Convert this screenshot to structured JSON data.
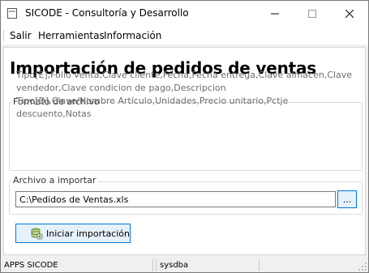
{
  "window": {
    "title": "SICODE - Consultoría y Desarrollo"
  },
  "menu": {
    "items": [
      "Salir",
      "Herramientas",
      "Información"
    ]
  },
  "page": {
    "title": "Importación de pedidos de ventas"
  },
  "format_group": {
    "label": "Formato de archivo",
    "lines": [
      "Tipo[E],Folio venta,Clave cliente,Fecha,Fecha entrega,Clave almacen,Clave",
      "vendedor,Clave condicion de pago,Descripcion",
      "Tipo[D],Clave/Nombre Artículo,Unidades,Precio unitario,Pctje descuento,Notas"
    ]
  },
  "file_group": {
    "label": "Archivo a importar",
    "value": "C:\\Pedidos de Ventas.xls",
    "browse_label": "..."
  },
  "import_button": {
    "label": "Iniciar importación"
  },
  "status": {
    "app": "APPS SICODE",
    "user": "sysdba"
  }
}
